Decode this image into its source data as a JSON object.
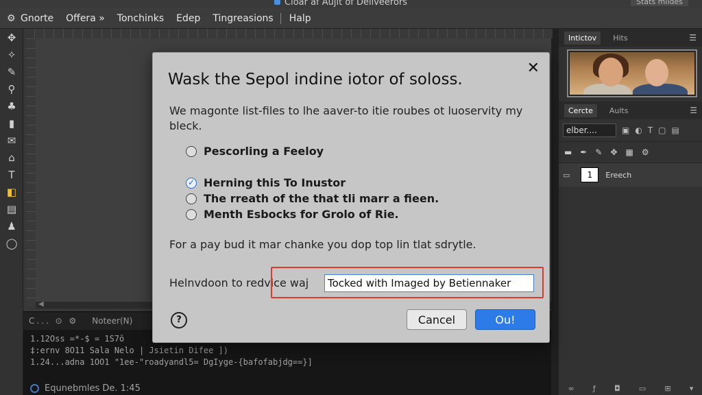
{
  "window": {
    "title": "Cloar af Aujit of Deliveerors",
    "status": "Stats mildes"
  },
  "menu": [
    "Gnorte",
    "Offera »",
    "Tonchinks",
    "Edep",
    "Tingreasions",
    "Halp"
  ],
  "toolbar": {
    "tools": [
      "move-icon",
      "lasso-icon",
      "brush-icon",
      "zoom-icon",
      "stamp-icon",
      "rectangle-icon",
      "envelope-icon",
      "shape-icon",
      "text-icon",
      "layer-icon",
      "history-icon",
      "pin-icon",
      "circle-icon"
    ]
  },
  "console": {
    "tabs": [
      "C... ⊙ ⚙",
      "Noteer(N)"
    ],
    "lines": [
      "1.12Oss =*-$ = 1S7ō  ",
      "‡:ernv 8O11 Sala Nelo | Jsietin Difee ])",
      "1.24...adna 1OO1 \"1ee-\"roadyandl5= DgIyge-{bafofabjdg==}]"
    ],
    "status": "Equnebmles De. 1:45"
  },
  "right_panel": {
    "top_tabs": [
      "Intictov",
      "Hits"
    ],
    "layer_tabs": [
      "Cercte",
      "Aults"
    ],
    "layer_select": "elber....",
    "layer_name": "Ereech",
    "layer_thumb": "1"
  },
  "dialog": {
    "title": "Wask the Sepol indine iotor of soloss.",
    "description": "We magonte list-files to lhe aaver-to itie roubes ot luoservity my bleck.",
    "options": [
      {
        "label": "Pescorling a Feeloy",
        "checked": false
      },
      {
        "label": "Herning this To Inustor",
        "checked": true
      },
      {
        "label": "The rreath of the that tli marr a fieen.",
        "checked": false
      },
      {
        "label": "Menth Esbocks for Grolo of Rie.",
        "checked": false
      }
    ],
    "note": "For a pay bud it mar chanke you dop top lin tlat sdrytle.",
    "field_label": "Helnvdoon to redvice waj",
    "field_value": "Tocked with Imaged by Betiennaker",
    "cancel": "Cancel",
    "ok": "Ou!",
    "help": "?"
  }
}
